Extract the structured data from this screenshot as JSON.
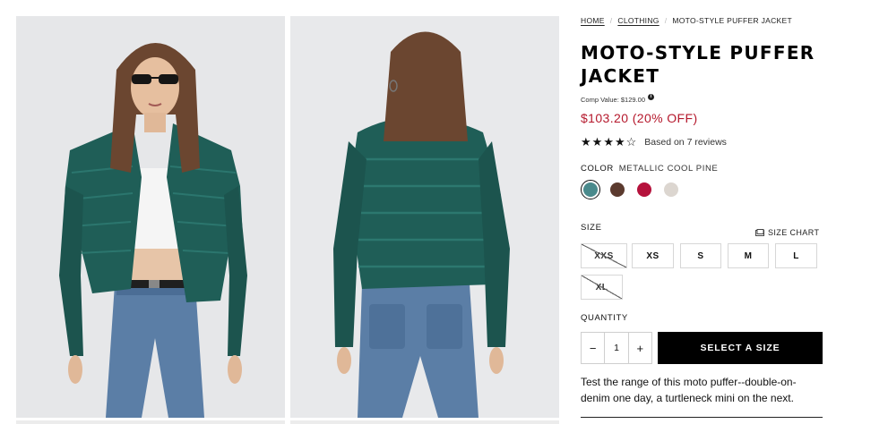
{
  "breadcrumb": {
    "items": [
      {
        "label": "HOME"
      },
      {
        "label": "CLOTHING"
      },
      {
        "label": "MOTO-STYLE PUFFER JACKET"
      }
    ]
  },
  "product": {
    "title": "MOTO-STYLE PUFFER JACKET",
    "comp_value": "Comp Value: $129.00",
    "price": "$103.20 (20% OFF)",
    "rating": 4,
    "rating_max": 5,
    "reviews_text": "Based on 7 reviews",
    "description": "Test the range of this moto puffer--double-on-denim one day, a turtleneck mini on the next."
  },
  "color": {
    "label": "COLOR",
    "selected_name": "METALLIC COOL PINE",
    "swatches": [
      {
        "hex": "#4a8a8c",
        "selected": true
      },
      {
        "hex": "#5b3a2e",
        "selected": false
      },
      {
        "hex": "#b5123c",
        "selected": false
      },
      {
        "hex": "#dcd6d0",
        "selected": false
      }
    ]
  },
  "size": {
    "label": "SIZE",
    "chart_label": "SIZE CHART",
    "options": [
      {
        "label": "XXS",
        "available": false
      },
      {
        "label": "XS",
        "available": true
      },
      {
        "label": "S",
        "available": true
      },
      {
        "label": "M",
        "available": true
      },
      {
        "label": "L",
        "available": true
      },
      {
        "label": "XL",
        "available": false
      }
    ]
  },
  "quantity": {
    "label": "QUANTITY",
    "value": "1",
    "minus": "−",
    "plus": "+"
  },
  "cta": {
    "label": "SELECT A SIZE"
  },
  "icons": {
    "info": "info-icon",
    "star_full": "★",
    "star_empty": "☆",
    "size_chart": "ruler-icon"
  },
  "colors": {
    "price": "#b5182c",
    "cta_bg": "#000000"
  }
}
